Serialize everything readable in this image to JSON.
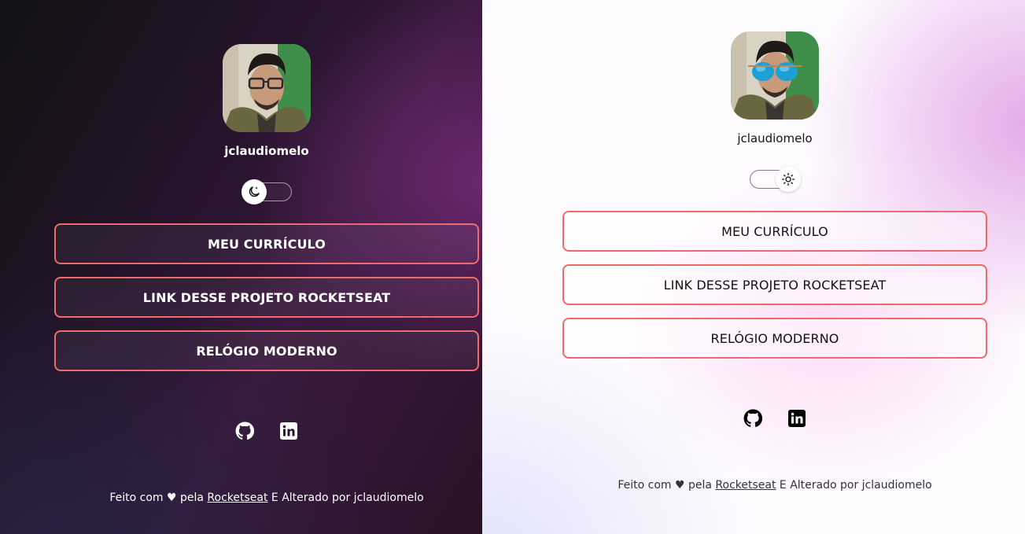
{
  "dark_panel": {
    "username": "jclaudiomelo",
    "theme_toggle": {
      "state": "dark",
      "icon": "moon-icon"
    },
    "buttons": [
      {
        "label": "MEU CURRÍCULO"
      },
      {
        "label": "LINK DESSE PROJETO ROCKETSEAT"
      },
      {
        "label": "RELÓGIO MODERNO"
      }
    ],
    "social": [
      {
        "icon": "github-icon"
      },
      {
        "icon": "linkedin-icon"
      }
    ],
    "footer": {
      "prefix": "Feito com ♥ pela ",
      "link": "Rocketseat",
      "suffix": " E Alterado por jclaudiomelo"
    }
  },
  "light_panel": {
    "username": "jclaudiomelo",
    "theme_toggle": {
      "state": "light",
      "icon": "sun-icon"
    },
    "buttons": [
      {
        "label": "MEU CURRÍCULO"
      },
      {
        "label": "LINK DESSE PROJETO ROCKETSEAT"
      },
      {
        "label": "RELÓGIO MODERNO"
      }
    ],
    "social": [
      {
        "icon": "github-icon"
      },
      {
        "icon": "linkedin-icon"
      }
    ],
    "footer": {
      "prefix": "Feito com ♥ pela ",
      "link": "Rocketseat",
      "suffix": " E Alterado por jclaudiomelo"
    }
  },
  "colors": {
    "button_border": "#ef6b6b",
    "dark_text": "#ffffff",
    "light_text": "#121214"
  }
}
